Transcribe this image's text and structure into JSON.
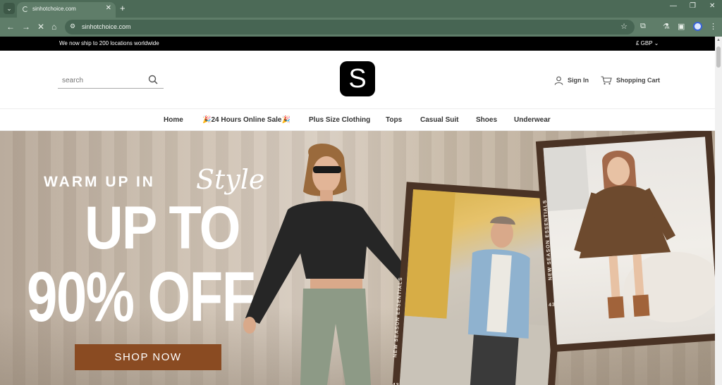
{
  "browser": {
    "tab_title": "sinhotchoice.com",
    "url": "sinhotchoice.com"
  },
  "announcement": {
    "text": "We now ship to 200 locations worldwide",
    "currency": "£ GBP ⌄"
  },
  "header": {
    "search_placeholder": "search",
    "logo_letter": "S",
    "sign_in": "Sign In",
    "cart": "Shopping Cart"
  },
  "nav": {
    "items": [
      "Home",
      "🎉24 Hours Online Sale🎉",
      "Plus Size Clothing",
      "Tops",
      "Casual Suit",
      "Shoes",
      "Underwear"
    ]
  },
  "hero": {
    "warm_up": "WARM UP IN",
    "style": "Style",
    "line1": "UP TO",
    "line2": "90% OFF",
    "cta": "SHOP NOW",
    "frame_label": "NEW SEASON ESSENTIALS",
    "frame_number": "43"
  },
  "colors": {
    "chrome": "#4c6a57",
    "toolbar": "#5f7d69",
    "cta": "#8a4b22",
    "frame": "#4a3325"
  }
}
